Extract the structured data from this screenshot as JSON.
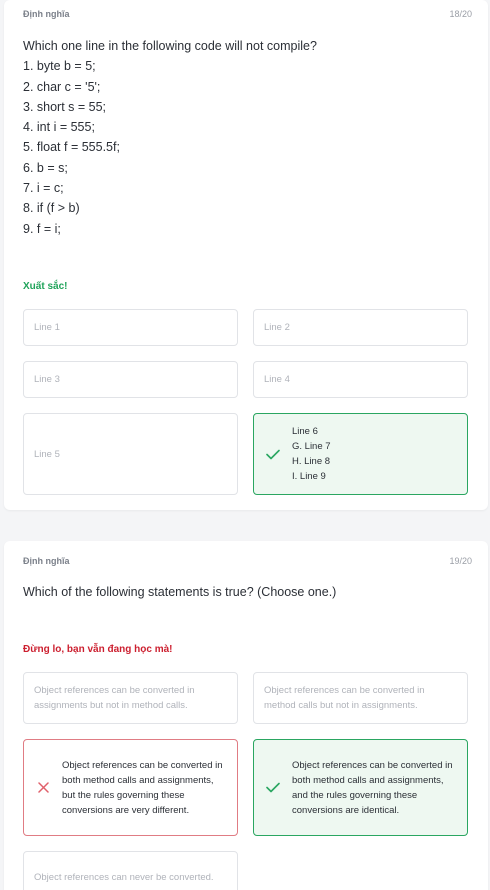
{
  "q1": {
    "tag": "Định nghĩa",
    "counter": "18/20",
    "question_lines": [
      "Which one line in the following code will not compile?",
      "1. byte b = 5;",
      "2. char c = '5';",
      "3. short s = 55;",
      "4. int i = 555;",
      "5. float f = 555.5f;",
      "6. b = s;",
      "7. i = c;",
      "8. if (f > b)",
      "9. f = i;"
    ],
    "feedback": "Xuất sắc!",
    "options": [
      {
        "label": "Line 1"
      },
      {
        "label": "Line 2"
      },
      {
        "label": "Line 3"
      },
      {
        "label": "Line 4"
      },
      {
        "label": "Line 5"
      },
      {
        "lines": [
          "Line 6",
          "G. Line 7",
          "H. Line 8",
          "I. Line 9"
        ],
        "status": "correct"
      }
    ]
  },
  "q2": {
    "tag": "Định nghĩa",
    "counter": "19/20",
    "question": "Which of the following statements is true? (Choose one.)",
    "feedback": "Đừng lo, bạn vẫn đang học mà!",
    "options": [
      {
        "label": "Object references can be converted in assignments but not in method calls."
      },
      {
        "label": "Object references can be converted in method calls but not in assignments."
      },
      {
        "label": "Object references can be converted in both method calls and assignments, but the rules governing these conversions are very different.",
        "status": "wrong"
      },
      {
        "label": "Object references can be converted in both method calls and assignments, and the rules governing these conversions are identical.",
        "status": "correct"
      },
      {
        "label": "Object references can never be converted."
      }
    ]
  },
  "colors": {
    "success": "#20a35a",
    "error": "#cc1f2f",
    "correct_border": "#2aa661",
    "correct_bg": "#eef8f1",
    "wrong_border": "#e07c84"
  },
  "icons": {
    "correct": "checkmark-icon",
    "wrong": "x-mark-icon"
  }
}
